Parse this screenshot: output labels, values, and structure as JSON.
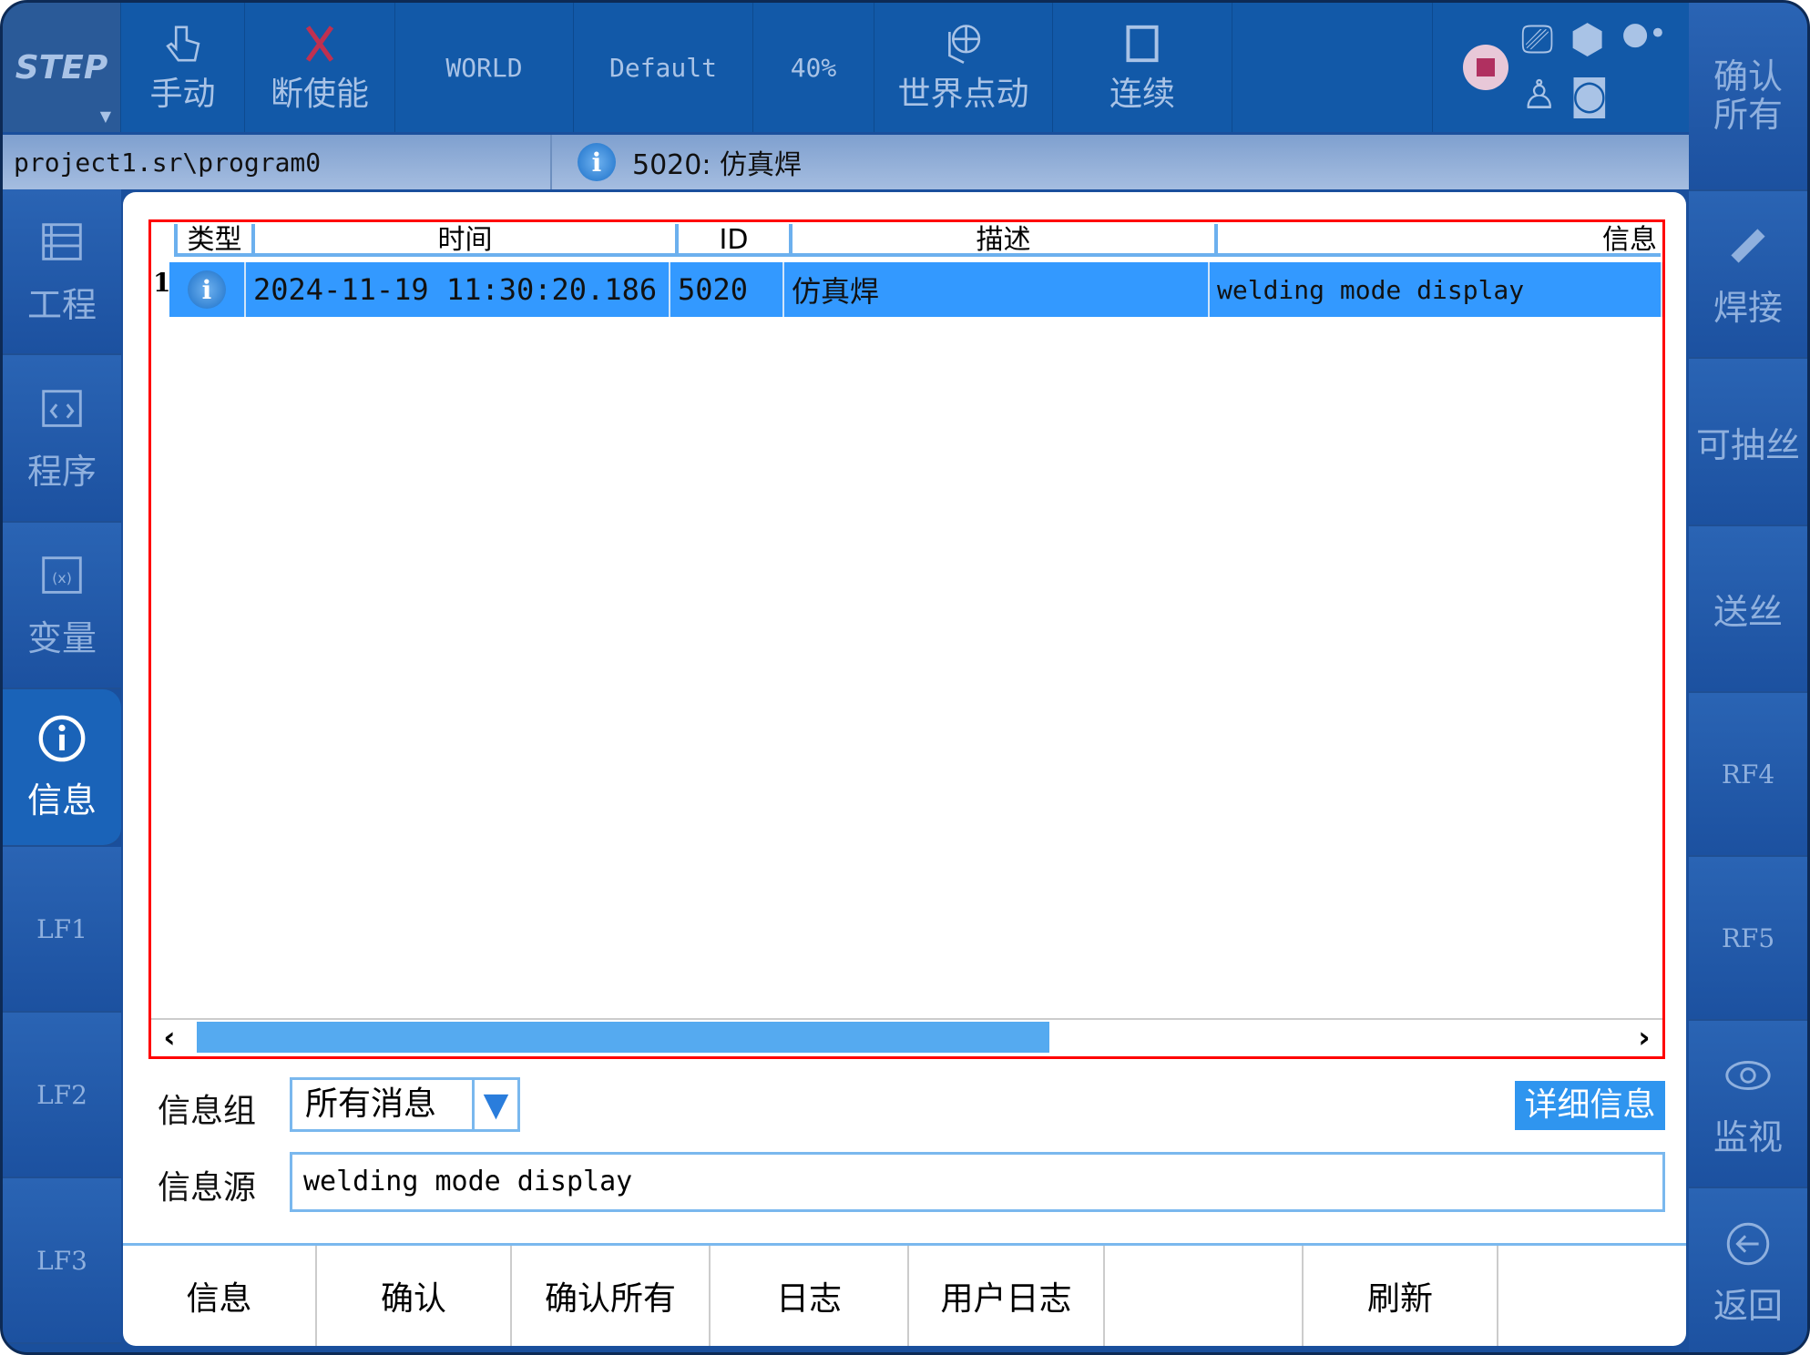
{
  "toolbar": {
    "mode": "STEP",
    "manual": "手动",
    "disable": "断使能",
    "coord": "WORLD",
    "tool": "Default",
    "speed": "40%",
    "jog": "世界点动",
    "continuous": "连续",
    "confirm_all": "确认\n所有"
  },
  "pathbar": {
    "path": "project1.sr\\program0",
    "message": "5020: 仿真焊"
  },
  "left_sidebar": [
    {
      "label": "工程",
      "icon": "project-list-icon"
    },
    {
      "label": "程序",
      "icon": "code-icon"
    },
    {
      "label": "变量",
      "icon": "variable-icon"
    },
    {
      "label": "信息",
      "icon": "info-icon",
      "active": true
    },
    {
      "label": "LF1"
    },
    {
      "label": "LF2"
    },
    {
      "label": "LF3"
    }
  ],
  "right_sidebar": [
    {
      "label": "确认所有"
    },
    {
      "label": "焊接",
      "icon": "welding-torch-icon"
    },
    {
      "label": "可抽丝"
    },
    {
      "label": "送丝"
    },
    {
      "label": "RF4"
    },
    {
      "label": "RF5"
    },
    {
      "label": "监视",
      "icon": "eye-icon"
    },
    {
      "label": "返回",
      "icon": "back-arrow-icon"
    }
  ],
  "table": {
    "headers": [
      "类型",
      "时间",
      "ID",
      "描述",
      "信息"
    ],
    "rows": [
      {
        "index": "1",
        "type": "info",
        "time": "2024-11-19 11:30:20.186",
        "id": "5020",
        "desc": "仿真焊",
        "info": "welding mode display"
      }
    ],
    "scroll_fraction": 0.6
  },
  "filter": {
    "group_label": "信息组",
    "group_value": "所有消息",
    "detail_button": "详细信息",
    "source_label": "信息源",
    "source_value": "welding mode display"
  },
  "bottom_buttons": [
    "信息",
    "确认",
    "确认所有",
    "日志",
    "用户日志",
    "",
    "刷新",
    ""
  ],
  "colors": {
    "accent": "#3399ff",
    "toolbar": "#1259a8",
    "highlight_border": "#ff0000"
  }
}
